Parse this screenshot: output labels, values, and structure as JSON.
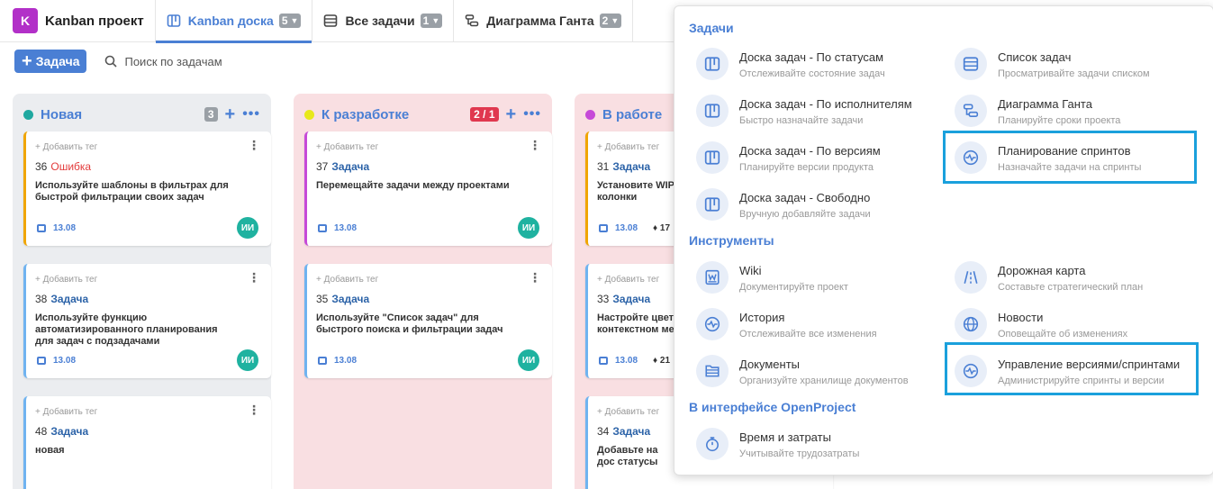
{
  "project": {
    "avatar_letter": "K",
    "name": "Kanban проект"
  },
  "tabs": [
    {
      "label": "Kanban доска",
      "count": "5",
      "icon": "board-icon"
    },
    {
      "label": "Все задачи",
      "count": "1",
      "icon": "list-icon"
    },
    {
      "label": "Диаграмма Ганта",
      "count": "2",
      "icon": "gantt-icon"
    }
  ],
  "toolbar": {
    "add_label": "Задача",
    "search_placeholder": "Поиск по задачам"
  },
  "columns": [
    {
      "title": "Новая",
      "count": "3",
      "dot_color": "#1fa8a0",
      "cards": [
        {
          "tag": "+ Добавить тег",
          "id": "36",
          "type": "Ошибка",
          "desc": "Используйте шаблоны в фильтрах для быстрой фильтрации своих задач",
          "date": "13.08",
          "avatar": "ИИ"
        },
        {
          "tag": "+ Добавить тег",
          "id": "38",
          "type": "Задача",
          "desc": "Используйте функцию автоматизированного планирования для задач с подзадачами",
          "date": "13.08",
          "avatar": "ИИ"
        },
        {
          "tag": "+ Добавить тег",
          "id": "48",
          "type": "Задача",
          "desc": "новая"
        }
      ]
    },
    {
      "title": "К разработке",
      "count": "2 / 1",
      "dot_color": "#e8e81a",
      "cards": [
        {
          "tag": "+ Добавить тег",
          "id": "37",
          "type": "Задача",
          "desc": "Перемещайте задачи между проектами",
          "date": "13.08",
          "avatar": "ИИ"
        },
        {
          "tag": "+ Добавить тег",
          "id": "35",
          "type": "Задача",
          "desc": "Используйте \"Список задач\" для быстрого поиска и фильтрации задач",
          "date": "13.08",
          "avatar": "ИИ"
        }
      ]
    },
    {
      "title": "В работе",
      "dot_color": "#c64ad8",
      "cards": [
        {
          "tag": "+ Добавить тег",
          "id": "31",
          "type": "Задача",
          "desc": "Установите WIP колонки",
          "date": "13.08",
          "stat": "17"
        },
        {
          "tag": "+ Добавить тег",
          "id": "33",
          "type": "Задача",
          "desc": "Настройте цвет контекстном ме",
          "date": "13.08",
          "stat": "21"
        },
        {
          "tag": "+ Добавить тег",
          "id": "34",
          "type": "Задача",
          "desc": "Добавьте на дос статусы"
        }
      ]
    }
  ],
  "menu": {
    "sections": {
      "tasks": "Задачи",
      "tools": "Инструменты",
      "openproject": "В интерфейсе OpenProject"
    },
    "tasks_items": [
      {
        "title": "Доска задач - По статусам",
        "sub": "Отслеживайте состояние задач",
        "icon": "board-icon"
      },
      {
        "title": "Список задач",
        "sub": "Просматривайте задачи списком",
        "icon": "list-icon"
      },
      {
        "title": "Доска задач - По исполнителям",
        "sub": "Быстро назначайте задачи",
        "icon": "board-icon"
      },
      {
        "title": "Диаграмма Ганта",
        "sub": "Планируйте сроки проекта",
        "icon": "gantt-icon"
      },
      {
        "title": "Доска задач - По версиям",
        "sub": "Планируйте версии продукта",
        "icon": "board-icon"
      },
      {
        "title": "Планирование спринтов",
        "sub": "Назначайте задачи на спринты",
        "icon": "pulse-icon"
      },
      {
        "title": "Доска задач - Свободно",
        "sub": "Вручную добавляйте задачи",
        "icon": "board-icon"
      }
    ],
    "tools_items": [
      {
        "title": "Wiki",
        "sub": "Документируйте проект",
        "icon": "wiki-icon"
      },
      {
        "title": "Дорожная карта",
        "sub": "Составьте стратегический план",
        "icon": "roadmap-icon"
      },
      {
        "title": "История",
        "sub": "Отслеживайте все изменения",
        "icon": "pulse-icon"
      },
      {
        "title": "Новости",
        "sub": "Оповещайте об изменениях",
        "icon": "globe-icon"
      },
      {
        "title": "Документы",
        "sub": "Организуйте хранилище документов",
        "icon": "documents-icon"
      },
      {
        "title": "Управление версиями/спринтами",
        "sub": "Администрируйте спринты и версии",
        "icon": "pulse-icon"
      }
    ],
    "op_items": [
      {
        "title": "Время и затраты",
        "sub": "Учитывайте трудозатраты",
        "icon": "stopwatch-icon"
      }
    ]
  },
  "colors": {
    "accent": "#4a7fd4",
    "highlight": "#1aa0dc",
    "avatar": "#1fb2a0",
    "bug": "#e33b3b"
  }
}
